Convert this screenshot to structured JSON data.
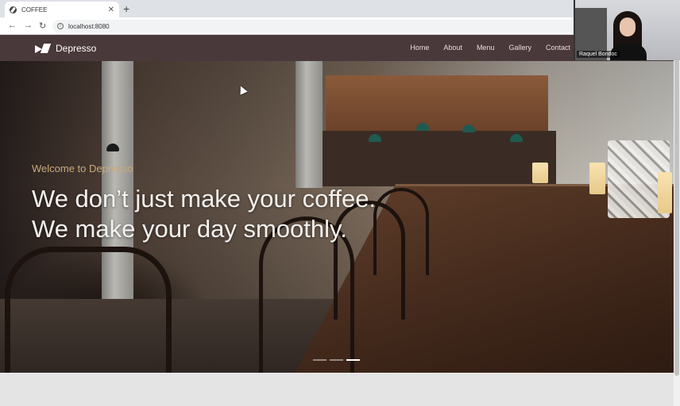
{
  "browser": {
    "tab_title": "COFFEE",
    "tab_close": "✕",
    "new_tab": "+",
    "back": "←",
    "forward": "→",
    "reload": "↻",
    "url": "localhost:8080"
  },
  "site": {
    "brand": "Depresso",
    "nav": [
      "Home",
      "About",
      "Menu",
      "Gallery",
      "Contact"
    ]
  },
  "hero": {
    "welcome": "Welcome to Depresso",
    "headline_line1": "We don’t just make your coffee.",
    "headline_line2": "We make your day smoothly.",
    "slides": 3,
    "active_slide": 3
  },
  "webcam": {
    "name": "Raquel Bondoc"
  }
}
